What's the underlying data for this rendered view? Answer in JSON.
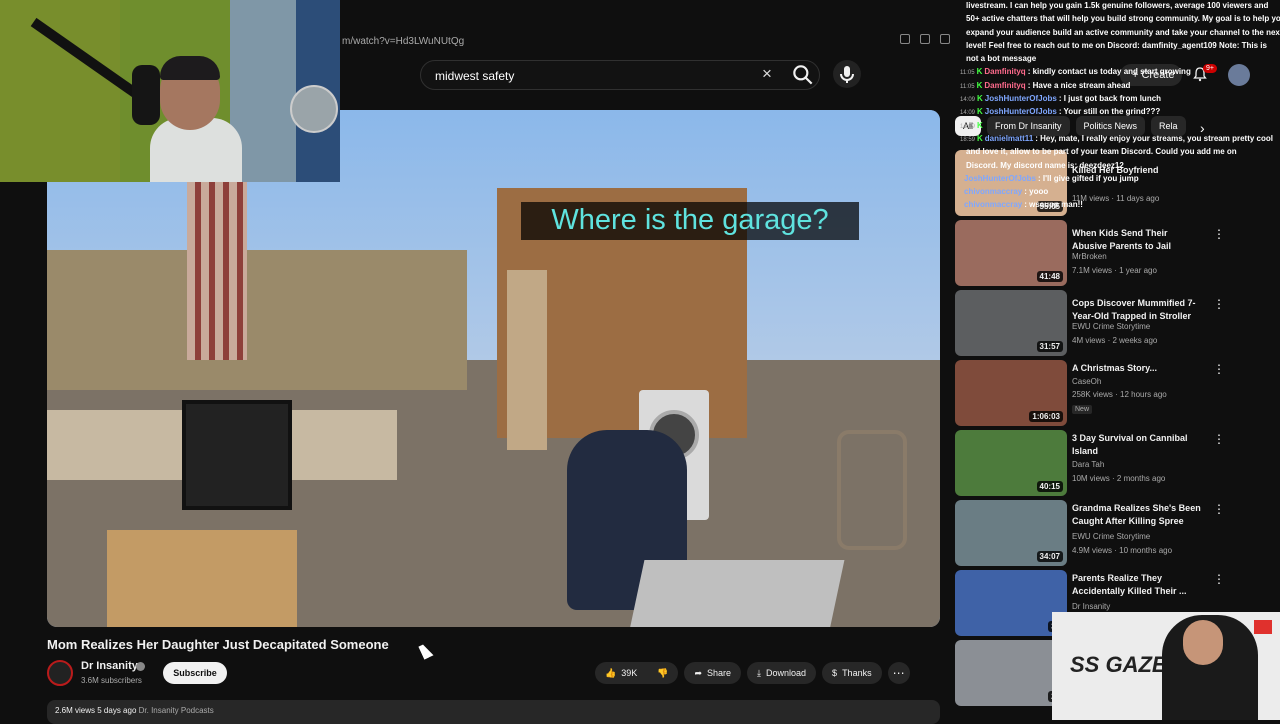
{
  "browser": {
    "url": "m/watch?v=Hd3LWuNUtQg"
  },
  "header": {
    "search_query": "midwest safety",
    "create_label": "Create",
    "notif_badge": "9+"
  },
  "video": {
    "caption": "Where is the garage?",
    "title": "Mom Realizes Her Daughter Just Decapitated Someone"
  },
  "channel": {
    "name": "Dr Insanity",
    "subscribers": "3.6M subscribers",
    "subscribe_label": "Subscribe"
  },
  "actions": {
    "likes": "39K",
    "share": "Share",
    "download": "Download",
    "thanks": "Thanks"
  },
  "meta": {
    "views": "2.6M views",
    "age": "5 days ago",
    "playlist": "Dr. Insanity Podcasts"
  },
  "chips": [
    "All",
    "From Dr Insanity",
    "Politics News",
    "Rela"
  ],
  "chat": [
    {
      "time": "",
      "user": "",
      "message": "livestream. I can help you gain 1.5k genuine followers, average 100 viewers and"
    },
    {
      "time": "",
      "user": "",
      "message": "50+ active chatters that will help you build strong community. My goal is to help you"
    },
    {
      "time": "",
      "user": "",
      "message": "expand your audience build an active community and take your channel to the next"
    },
    {
      "time": "",
      "user": "",
      "message": "level! Feel free to reach out to me on Discord: damfinity_agent109 Note: This is"
    },
    {
      "time": "",
      "user": "",
      "message": "not a bot message"
    },
    {
      "time": "11:05",
      "user": "Damfinityq",
      "message": ": kindly contact us today and start growing"
    },
    {
      "time": "11:05",
      "user": "Damfinityq",
      "message": ": Have a nice stream ahead"
    },
    {
      "time": "14:09",
      "user": "JoshHunterOfJobs",
      "message": ": I just got back from lunch"
    },
    {
      "time": "14:09",
      "user": "JoshHunterOfJobs",
      "message": ": Your still on the grind???"
    },
    {
      "time": "14:09",
      "user": "",
      "message": ""
    },
    {
      "time": "18:59",
      "user": "danielmatt11",
      "message": ": Hey, mate, I really enjoy your streams, you stream pretty cool"
    },
    {
      "time": "",
      "user": "",
      "message": "and love it, allow to be part of your team Discord. Could you add me on"
    },
    {
      "time": "",
      "user": "",
      "message": "Discord. My discord name is: deezdeez12"
    },
    {
      "time": "",
      "user": "JoshHunterOfJobs",
      "message": ": I'll give gifted if you jump"
    },
    {
      "time": "",
      "user": "chivonmaccray",
      "message": ": yooo"
    },
    {
      "time": "",
      "user": "chivonmaccray",
      "message": ": wsaupp man!!"
    }
  ],
  "recommendations": [
    {
      "title": "Killed Her Boyfriend",
      "channel": "",
      "views": "11M views · 11 days ago",
      "duration": "55:05",
      "badge": ""
    },
    {
      "title": "When Kids Send Their Abusive Parents to Jail",
      "channel": "MrBroken",
      "views": "7.1M views · 1 year ago",
      "duration": "41:48",
      "badge": ""
    },
    {
      "title": "Cops Discover Mummified 7-Year-Old Trapped in Stroller",
      "channel": "EWU Crime Storytime",
      "views": "4M views · 2 weeks ago",
      "duration": "31:57",
      "badge": ""
    },
    {
      "title": "A Christmas Story...",
      "channel": "CaseOh",
      "views": "258K views · 12 hours ago",
      "duration": "1:06:03",
      "badge": "New"
    },
    {
      "title": "3 Day Survival on Cannibal Island",
      "channel": "Dara Tah",
      "views": "10M views · 2 months ago",
      "duration": "40:15",
      "badge": ""
    },
    {
      "title": "Grandma Realizes She's Been Caught After Killing Spree",
      "channel": "EWU Crime Storytime",
      "views": "4.9M views · 10 months ago",
      "duration": "34:07",
      "badge": ""
    },
    {
      "title": "Parents Realize They Accidentally Killed Their ...",
      "channel": "Dr Insanity",
      "views": "",
      "duration": "38",
      "badge": ""
    },
    {
      "title": "",
      "channel": "",
      "views": "",
      "duration": "22",
      "badge": ""
    }
  ],
  "ad": {
    "title": "SS GAZE"
  },
  "colors": {
    "background": "#0f0f0f",
    "caption_text": "#5fe3df",
    "moderator": "#42ff42",
    "accent": "#cc0000"
  }
}
